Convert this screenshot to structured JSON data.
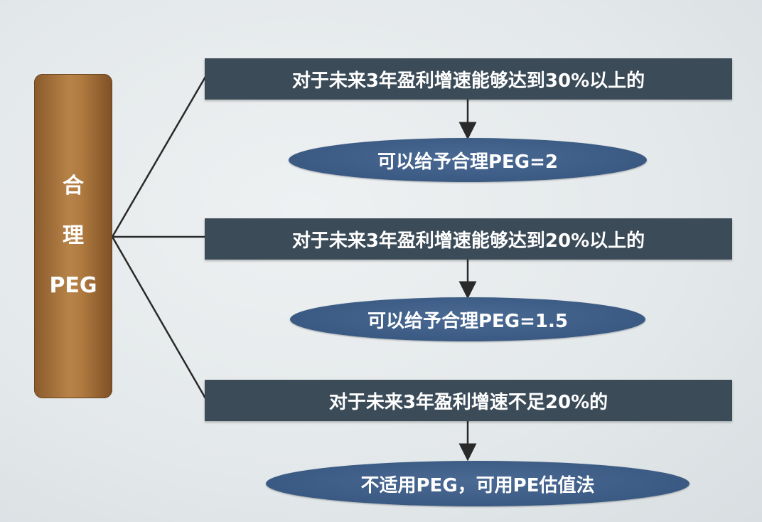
{
  "root": {
    "chars": [
      "合",
      "理",
      "PEG"
    ]
  },
  "branches": [
    {
      "condition": "对于未来3年盈利增速能够达到30%以上的",
      "result": "可以给予合理PEG=2"
    },
    {
      "condition": "对于未来3年盈利增速能够达到20%以上的",
      "result": "可以给予合理PEG=1.5"
    },
    {
      "condition": "对于未来3年盈利增速不足20%的",
      "result": "不适用PEG，可用PE估值法"
    }
  ],
  "colors": {
    "root_box": "#b07b40",
    "condition_box": "#3b4b58",
    "result_oval": "#3a5a83",
    "connector": "#2a2a2a",
    "text": "#ffffff"
  }
}
